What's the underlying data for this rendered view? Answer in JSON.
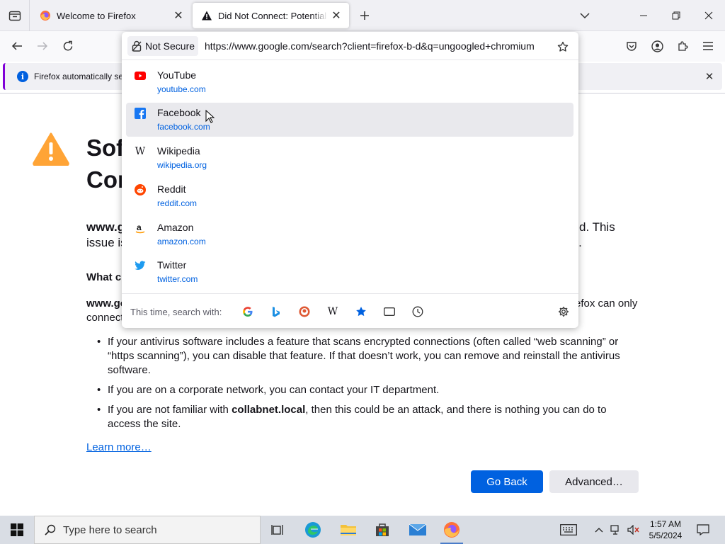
{
  "tabs": [
    {
      "title": "Welcome to Firefox",
      "favicon": "firefox-icon"
    },
    {
      "title": "Did Not Connect: Potential Security Issue",
      "favicon": "warning-icon",
      "active": true
    }
  ],
  "urlbar": {
    "security_label": "Not Secure",
    "url": "https://www.google.com/search?client=firefox-b-d&q=ungoogled+chromium"
  },
  "notification": {
    "message": "Firefox automatically se"
  },
  "suggestions": [
    {
      "name": "YouTube",
      "url": "youtube.com",
      "icon": "youtube-icon",
      "color": "#ff0000"
    },
    {
      "name": "Facebook",
      "url": "facebook.com",
      "icon": "facebook-icon",
      "color": "#1877f2",
      "hovered": true
    },
    {
      "name": "Wikipedia",
      "url": "wikipedia.org",
      "icon": "wikipedia-icon",
      "color": "#000000"
    },
    {
      "name": "Reddit",
      "url": "reddit.com",
      "icon": "reddit-icon",
      "color": "#ff4500"
    },
    {
      "name": "Amazon",
      "url": "amazon.com",
      "icon": "amazon-icon",
      "color": "#000000"
    },
    {
      "name": "Twitter",
      "url": "twitter.com",
      "icon": "twitter-icon",
      "color": "#1d9bf0"
    }
  ],
  "search_with": {
    "label": "This time, search with:",
    "engines": [
      "google-icon",
      "bing-icon",
      "duckduckgo-icon",
      "wikipedia-icon",
      "bookmarks-icon",
      "tabs-icon",
      "history-icon"
    ]
  },
  "page": {
    "heading_line1": "Sof",
    "heading_line2": "Cor",
    "para1_start_bold": "www.g",
    "para1_line2_start": "issue is",
    "para1_tail1": "d. This",
    "para1_tail2": "rk.",
    "what_heading": "What c",
    "para2_start_bold": "www.go",
    "para2_line2": "connect",
    "para2_tail": "efox can only",
    "bullet1": "If your antivirus software includes a feature that scans encrypted connections (often called “web scanning” or “https scanning”), you can disable that feature. If that doesn’t work, you can remove and reinstall the antivirus software.",
    "bullet2": "If you are on a corporate network, you can contact your IT department.",
    "bullet3_pre": "If you are not familiar with ",
    "bullet3_bold": "collabnet.local",
    "bullet3_post": ", then this could be an attack, and there is nothing you can do to access the site.",
    "learn_more": "Learn more…",
    "go_back": "Go Back",
    "advanced": "Advanced…"
  },
  "taskbar": {
    "search_placeholder": "Type here to search",
    "time": "1:57 AM",
    "date": "5/5/2024"
  },
  "colors": {
    "accent": "#0061e0",
    "warning": "#ffa436"
  }
}
